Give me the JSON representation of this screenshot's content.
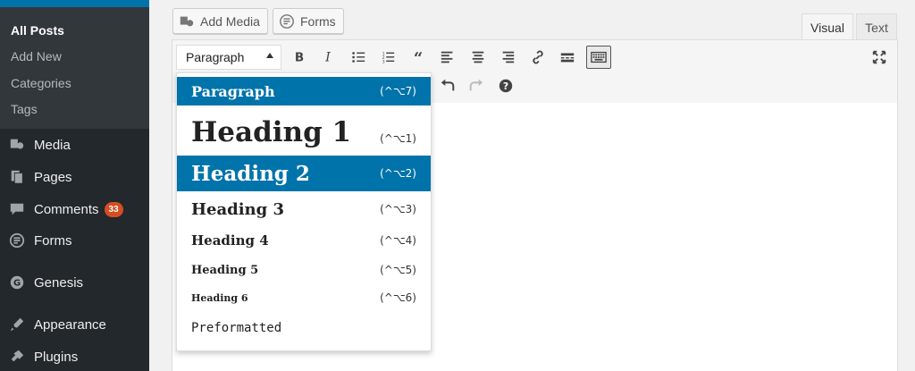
{
  "sidebar": {
    "submenu": [
      "All Posts",
      "Add New",
      "Categories",
      "Tags"
    ],
    "menu": [
      {
        "label": "Media",
        "icon": "media-icon"
      },
      {
        "label": "Pages",
        "icon": "pages-icon"
      },
      {
        "label": "Comments",
        "icon": "comments-icon",
        "badge": "33"
      },
      {
        "label": "Forms",
        "icon": "forms-icon"
      },
      {
        "label": "Genesis",
        "icon": "genesis-icon"
      },
      {
        "label": "Appearance",
        "icon": "appearance-icon"
      },
      {
        "label": "Plugins",
        "icon": "plugins-icon"
      }
    ]
  },
  "media_buttons": {
    "add_media": "Add Media",
    "forms": "Forms"
  },
  "tabs": {
    "visual": "Visual",
    "text": "Text"
  },
  "toolbar": {
    "format_value": "Paragraph"
  },
  "dropdown": {
    "items": [
      {
        "label": "Paragraph",
        "shortcut": "(^⌥7)",
        "selected": true
      },
      {
        "label": "Heading 1",
        "shortcut": "(^⌥1)"
      },
      {
        "label": "Heading 2",
        "shortcut": "(^⌥2)",
        "highlighted": true
      },
      {
        "label": "Heading 3",
        "shortcut": "(^⌥3)"
      },
      {
        "label": "Heading 4",
        "shortcut": "(^⌥4)"
      },
      {
        "label": "Heading 5",
        "shortcut": "(^⌥5)"
      },
      {
        "label": "Heading 6",
        "shortcut": "(^⌥6)"
      },
      {
        "label": "Preformatted",
        "shortcut": ""
      }
    ]
  },
  "colors": {
    "accent": "#0073aa",
    "sidebar_bg": "#23282d",
    "badge": "#d54e21"
  }
}
